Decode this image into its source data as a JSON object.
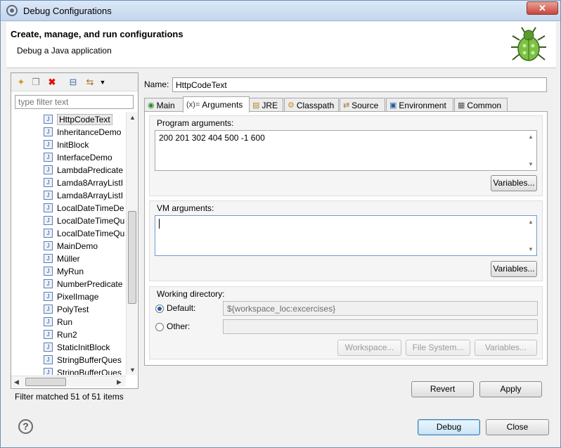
{
  "window": {
    "title": "Debug Configurations",
    "close_label": "✕"
  },
  "header": {
    "title": "Create, manage, and run configurations",
    "subtitle": "Debug a Java application"
  },
  "left": {
    "filter_placeholder": "type filter text",
    "items": [
      "HttpCodeText",
      "InheritanceDemo",
      "InitBlock",
      "InterfaceDemo",
      "LambdaPredicate",
      "Lamda8ArrayListI",
      "Lamda8ArrayListI",
      "LocalDateTimeDe",
      "LocalDateTimeQu",
      "LocalDateTimeQu",
      "MainDemo",
      "Müller",
      "MyRun",
      "NumberPredicate",
      "PixelImage",
      "PolyTest",
      "Run",
      "Run2",
      "StaticInitBlock",
      "StringBufferQues",
      "StringBufferQues"
    ],
    "selected_index": 0,
    "status": "Filter matched 51 of 51 items"
  },
  "config": {
    "name_label": "Name:",
    "name_value": "HttpCodeText",
    "tabs": [
      "Main",
      "Arguments",
      "JRE",
      "Classpath",
      "Source",
      "Environment",
      "Common"
    ],
    "active_tab": "Arguments",
    "program_args_label": "Program arguments:",
    "program_args_value": "200 201 302 404 500 -1 600",
    "vm_args_label": "VM arguments:",
    "vm_args_value": "",
    "variables_label": "Variables...",
    "working_dir_label": "Working directory:",
    "default_label": "Default:",
    "default_value": "${workspace_loc:excercises}",
    "other_label": "Other:",
    "workspace_btn": "Workspace...",
    "filesystem_btn": "File System...",
    "wd_variables_btn": "Variables..."
  },
  "buttons": {
    "revert": "Revert",
    "apply": "Apply",
    "debug": "Debug",
    "close": "Close"
  },
  "help": "?"
}
